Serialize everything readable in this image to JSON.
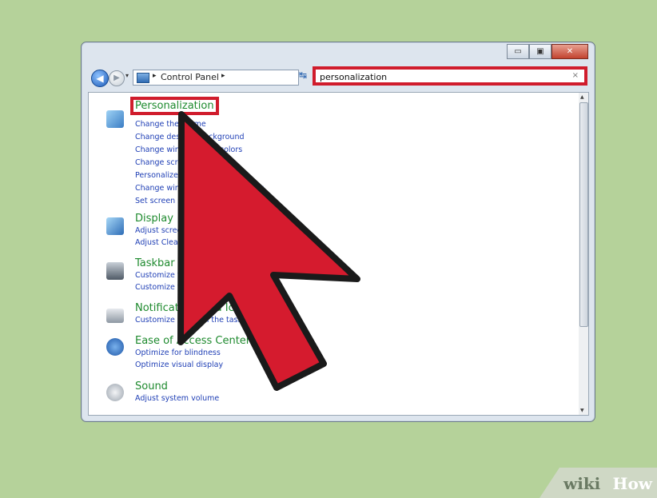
{
  "window": {
    "caption": {
      "minimize": "▭",
      "maximize": "▣",
      "close": "✕"
    },
    "nav": {
      "back": "◀",
      "forward": "▶",
      "dropdown": "▾"
    },
    "address": {
      "separator": "▸",
      "path": "Control Panel",
      "separator2": "▸",
      "dropdown": "▾"
    },
    "refresh": "↹",
    "search": {
      "value": "personalization",
      "clear": "×"
    }
  },
  "results": [
    {
      "title": "Personalization",
      "icon": "personalization-icon",
      "icon_color": "#4a8fd0",
      "links": [
        "Change the theme",
        "Change desktop background",
        "Change window glass colors",
        "Change screen saver",
        "Personalize icons for themes",
        "Change window color and metrics",
        "Set screen saver"
      ]
    },
    {
      "title": "Display",
      "icon": "display-icon",
      "icon_color": "#3d7fc6",
      "links": [
        "Adjust screen resolution",
        "Adjust ClearType text"
      ]
    },
    {
      "title": "Taskbar and Start Menu",
      "icon": "taskbar-icon",
      "icon_color": "#5f6b78",
      "links": [
        "Customize the Start menu",
        "Customize the taskbar"
      ]
    },
    {
      "title": "Notification Area Icons",
      "icon": "notification-icon",
      "icon_color": "#7c8794",
      "links": [
        "Customize icons on the taskbar"
      ]
    },
    {
      "title": "Ease of Access Center",
      "icon": "ease-of-access-icon",
      "icon_color": "#2f6bb8",
      "links": [
        "Optimize for blindness",
        "Optimize visual display"
      ]
    },
    {
      "title": "Sound",
      "icon": "sound-icon",
      "icon_color": "#9aa3ad",
      "links": [
        "Adjust system volume"
      ]
    }
  ],
  "watermark": {
    "a": "wiki",
    "b": "How"
  },
  "colors": {
    "highlight": "#d01c2c",
    "background": "#b5d29a"
  }
}
